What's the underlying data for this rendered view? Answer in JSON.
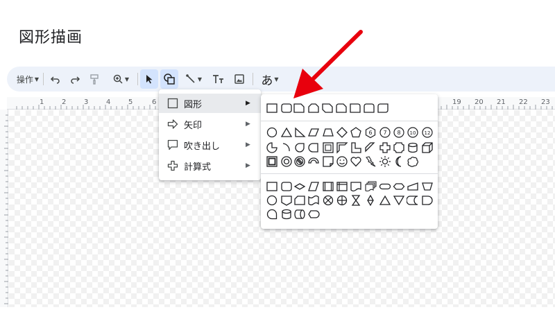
{
  "page": {
    "title": "図形描画"
  },
  "toolbar": {
    "actions_label": "操作",
    "text_style_label": "あ",
    "buttons": [
      "undo-icon",
      "redo-icon",
      "paint-format-icon",
      "zoom-icon",
      "select-icon",
      "shape-icon",
      "line-icon",
      "text-box-icon",
      "image-icon"
    ]
  },
  "ruler": {
    "numbers": [
      "1",
      "2",
      "3",
      "4",
      "5",
      "6",
      "19",
      "20",
      "21",
      "22",
      "23"
    ]
  },
  "menu": {
    "items": [
      {
        "label": "図形",
        "icon": "square-icon",
        "highlighted": true
      },
      {
        "label": "矢印",
        "icon": "arrow-right-icon"
      },
      {
        "label": "吹き出し",
        "icon": "callout-icon"
      },
      {
        "label": "計算式",
        "icon": "plus-icon"
      }
    ],
    "submenu_arrow": "▶"
  },
  "submenu": {
    "groups": [
      "shapes",
      "basic-shapes",
      "flowchart-shapes"
    ]
  },
  "colors": {
    "toolbar_bg": "#edf2fa",
    "active_button": "#d3e3fd",
    "highlight": "#e8eaed",
    "annotation": "#e8000d"
  }
}
